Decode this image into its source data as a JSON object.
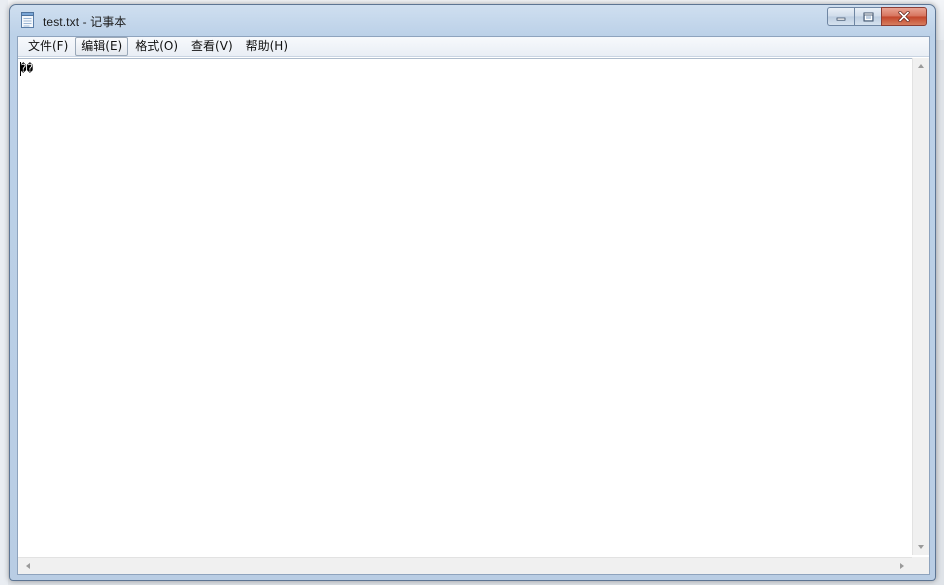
{
  "window": {
    "title": "test.txt - 记事本"
  },
  "menu": {
    "items": [
      {
        "label": "文件(F)"
      },
      {
        "label": "编辑(E)"
      },
      {
        "label": "格式(O)"
      },
      {
        "label": "查看(V)"
      },
      {
        "label": "帮助(H)"
      }
    ],
    "active_index": 1
  },
  "editor": {
    "content": "��"
  },
  "icons": {
    "app": "notepad-icon",
    "minimize": "minimize-icon",
    "maximize": "maximize-icon",
    "close": "close-icon"
  },
  "colors": {
    "close_button": "#c2442a",
    "frame": "#bcd1e8"
  }
}
